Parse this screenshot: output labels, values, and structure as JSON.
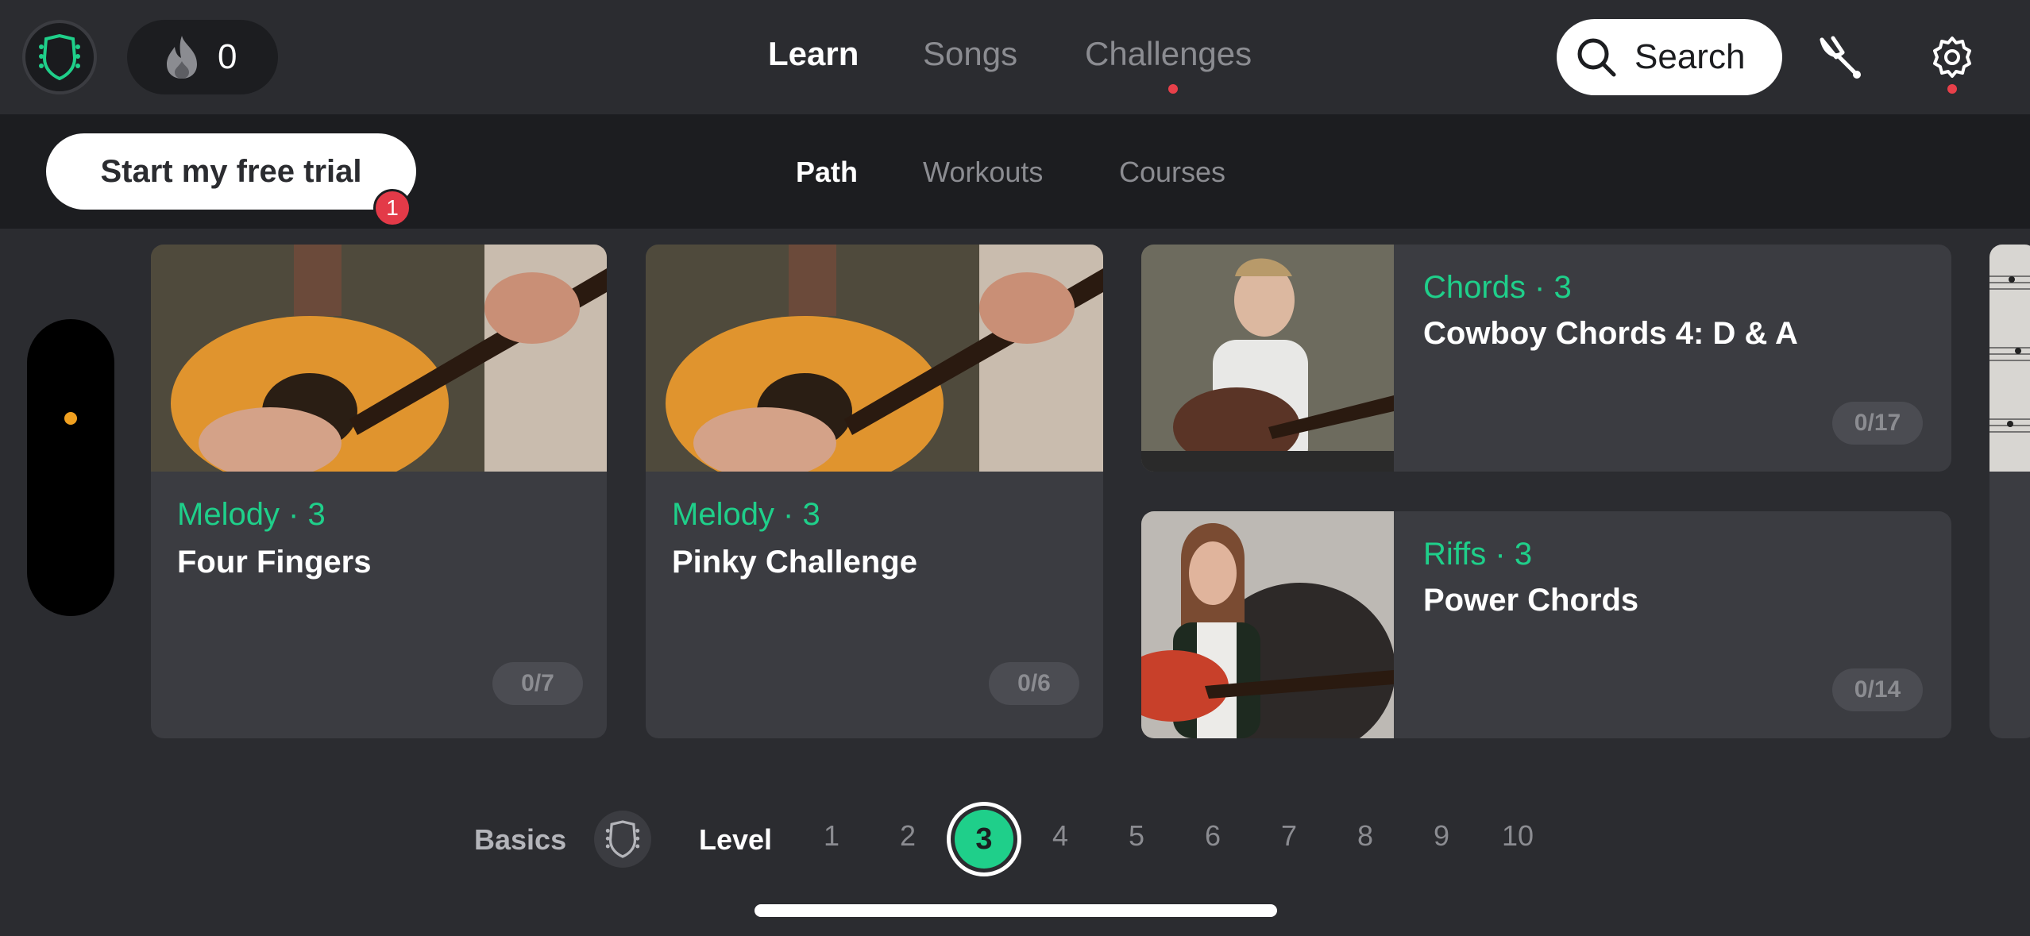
{
  "header": {
    "streak_count": "0",
    "tabs": [
      {
        "label": "Learn",
        "active": true
      },
      {
        "label": "Songs",
        "active": false
      },
      {
        "label": "Challenges",
        "active": false,
        "has_notification": true
      }
    ],
    "search_label": "Search",
    "icons": [
      "app-logo-icon",
      "flame-icon",
      "search-icon",
      "tuning-fork-icon",
      "gear-icon"
    ]
  },
  "subheader": {
    "trial_button": "Start my free trial",
    "trial_badge": "1",
    "tabs": [
      {
        "label": "Path",
        "active": true
      },
      {
        "label": "Workouts",
        "active": false
      },
      {
        "label": "Courses",
        "active": false
      }
    ]
  },
  "cards": [
    {
      "tag": "Melody · 3",
      "title": "Four Fingers",
      "progress": "0/7"
    },
    {
      "tag": "Melody · 3",
      "title": "Pinky Challenge",
      "progress": "0/6"
    },
    {
      "tag": "Chords · 3",
      "title": "Cowboy Chords 4: D & A",
      "progress": "0/17"
    },
    {
      "tag": "Riffs · 3",
      "title": "Power Chords",
      "progress": "0/14"
    }
  ],
  "levels": {
    "basics_label": "Basics",
    "level_label": "Level",
    "numbers": [
      "1",
      "2",
      "3",
      "4",
      "5",
      "6",
      "7",
      "8",
      "9",
      "10"
    ],
    "current": "3"
  },
  "colors": {
    "accent": "#1fcf8a",
    "background": "#2b2c30",
    "card": "#3b3c41",
    "notification": "#e33a48"
  }
}
